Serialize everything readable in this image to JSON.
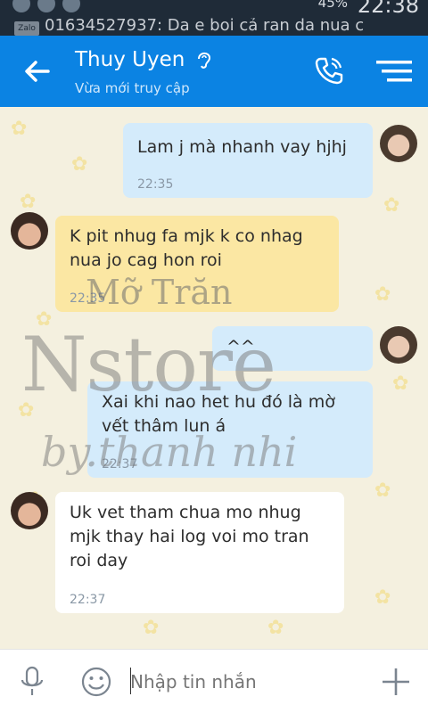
{
  "status_bar": {
    "battery": "45%",
    "clock": "22:38"
  },
  "notification": {
    "app": "Zalo",
    "text": "01634527937: Da e boi cả ran da nua c"
  },
  "header": {
    "contact_name": "Thuy Uyen",
    "status": "Vừa mới truy cập",
    "colors": {
      "bar": "#0b83e3"
    }
  },
  "messages": [
    {
      "side": "out",
      "text": "Lam j mà nhanh vay hjhj",
      "time": "22:35"
    },
    {
      "side": "in",
      "text": "K pit nhug fa mjk k co nhag nua jo cag hon roi",
      "time": "22:35",
      "highlighted": true
    },
    {
      "side": "out",
      "text": "^^",
      "time": ""
    },
    {
      "side": "out",
      "text": "Xai khi nao het hu đó là mờ vết thâm lun á",
      "time": "22:37"
    },
    {
      "side": "in",
      "text": "Uk vet tham chua mo nhug mjk thay hai log voi mo tran roi day",
      "time": "22:37"
    }
  ],
  "watermark": {
    "line1": "Mỡ Trăn",
    "line2": "Nstore",
    "line3": "by.thanh nhi"
  },
  "composer": {
    "placeholder": "Nhập tin nhắn"
  }
}
